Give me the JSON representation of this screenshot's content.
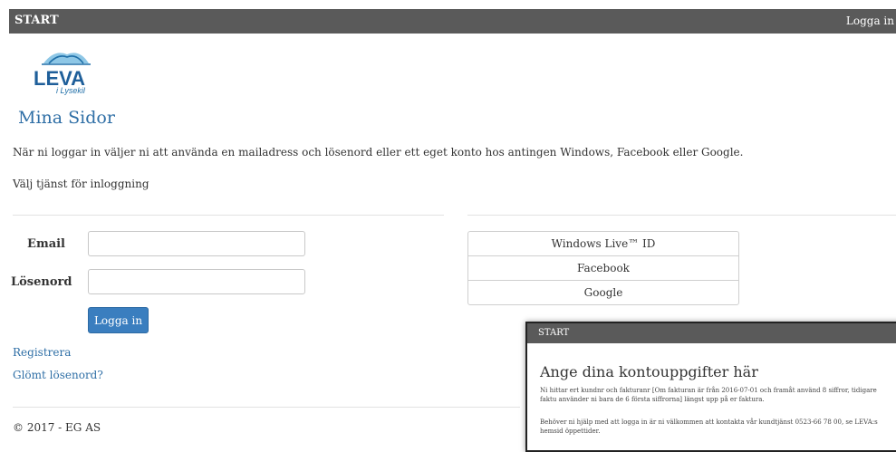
{
  "nav": {
    "brand": "START",
    "login_link": "Logga in"
  },
  "logo": {
    "text": "LEVA",
    "subtitle": "i Lysekil"
  },
  "page": {
    "title": "Mina Sidor",
    "intro": "När ni loggar in väljer ni att använda en mailadress och lösenord eller ett eget konto hos antingen Windows, Facebook eller Google.",
    "choose_service": "Välj tjänst för inloggning"
  },
  "login_form": {
    "email_label": "Email",
    "email_value": "",
    "password_label": "Lösenord",
    "password_value": "",
    "submit_label": "Logga in"
  },
  "links": {
    "register": "Registrera",
    "forgot_password": "Glömt lösenord?"
  },
  "providers": [
    "Windows Live™ ID",
    "Facebook",
    "Google"
  ],
  "footer": "© 2017 - EG AS",
  "popup": {
    "brand": "START",
    "title": "Ange dina kontouppgifter här",
    "text1": "Ni hittar ert kundnr och fakturanr [Om fakturan är från 2016-07-01 och framåt använd 8 siffror, tidigare faktu använder ni bara de 6 första siffrorna] längst upp på er faktura.",
    "text2": "Behöver ni hjälp med att logga in är ni välkommen att kontakta vår kundtjänst 0523-66 78 00, se LEVA:s hemsid öppettider."
  },
  "colors": {
    "nav_bg": "#5a5a5a",
    "accent": "#2f6fa6",
    "button": "#3a7ebf"
  }
}
